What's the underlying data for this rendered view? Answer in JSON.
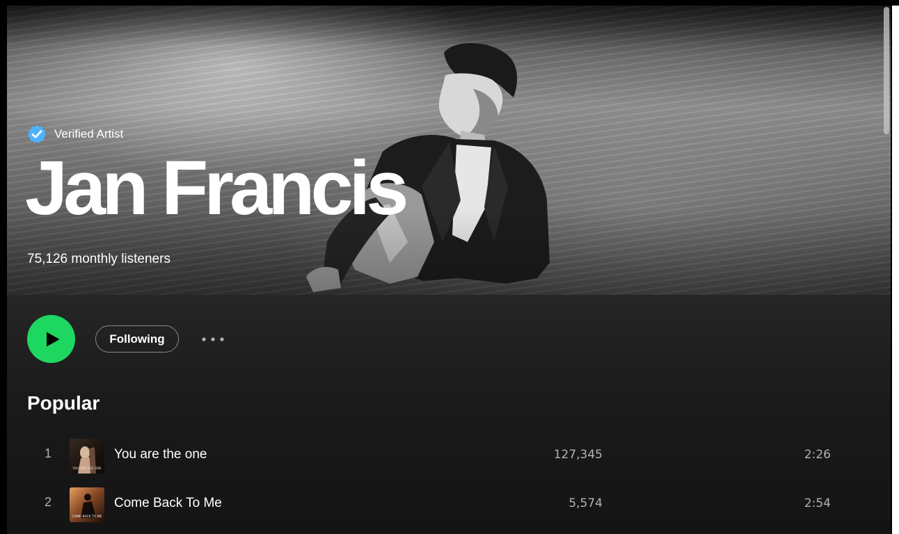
{
  "artist": {
    "verified_label": "Verified Artist",
    "name": "Jan Francis",
    "listeners": "75,126 monthly listeners"
  },
  "actions": {
    "follow_label": "Following"
  },
  "popular": {
    "title": "Popular",
    "tracks": [
      {
        "number": "1",
        "title": "You are the one",
        "plays": "127,345",
        "duration": "2:26",
        "art_text": "YOU ARE THE ONE"
      },
      {
        "number": "2",
        "title": "Come Back To Me",
        "plays": "5,574",
        "duration": "2:54",
        "art_text": "COME BACK TO ME"
      }
    ]
  },
  "colors": {
    "accent": "#1ed760",
    "verified": "#4cb3ff",
    "background": "#121212"
  },
  "icons": [
    "verified-badge-icon",
    "play-icon",
    "more-options-icon"
  ]
}
